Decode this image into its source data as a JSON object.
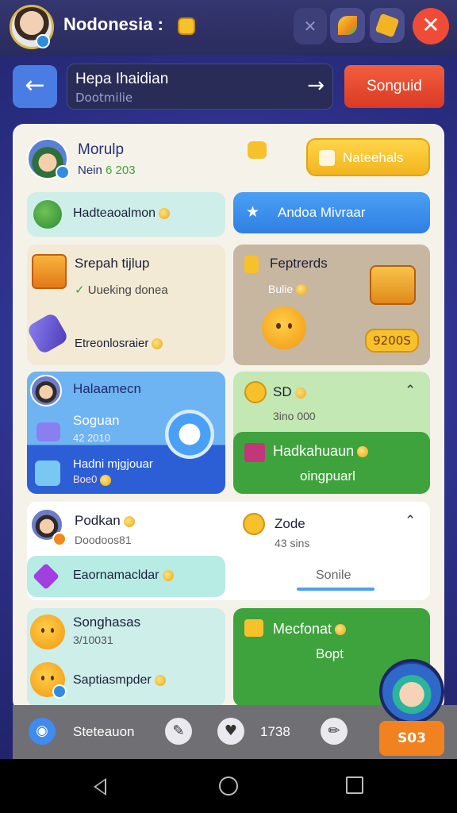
{
  "top": {
    "title": "Nodonesia :",
    "pill_icon": "x-icon"
  },
  "header": {
    "location_name": "Hepa Ihaidian",
    "location_sub": "Dootmilie",
    "arrow": "→",
    "red_button": "Songuid"
  },
  "profile": {
    "name": "Morulp",
    "level_prefix": "Nein",
    "level_value": "6 203",
    "gold_button": "Nateehals"
  },
  "row1": {
    "left_label": "Hadteaoalmon",
    "right_button": "Andoa Mivraar"
  },
  "row2": {
    "left_title": "Srepah tijlup",
    "left_sub": "Uueking donea",
    "left_bottom": "Etreonlosraier",
    "right_title": "Feptrerds",
    "right_sub": "Bulie",
    "right_price": "9200S"
  },
  "row3": {
    "left_title": "Halaamecn",
    "left_item1_title": "Soguan",
    "left_item1_sub": "42 2010",
    "left_item2_title": "Hadni mjgjouar",
    "left_item2_sub": "Boe0",
    "right_top_title": "SD",
    "right_top_sub": "3ino 000",
    "right_item_title": "Hadkahuaun",
    "right_item_sub": "oingpuarl"
  },
  "row4": {
    "left_title": "Podkan",
    "left_sub": "Doodoos81",
    "right_title": "Zode",
    "right_sub": "43 sins",
    "left_bar": "Eaornamacldar",
    "right_bar": "Sonile"
  },
  "row5": {
    "left_title": "Songhasas",
    "left_sub": "3/10031",
    "left_bottom": "Saptiasmpder",
    "right_title": "Mecfonat",
    "right_sub": "Bopt"
  },
  "bottom": {
    "label": "Steteauon",
    "value": "1738",
    "corner_coins": "S03"
  },
  "colors": {
    "panel": "#f5f2e9",
    "accent_blue": "#3f8bef",
    "green": "#3ea33c",
    "gold": "#f6c12b",
    "red": "#ef4b37"
  }
}
